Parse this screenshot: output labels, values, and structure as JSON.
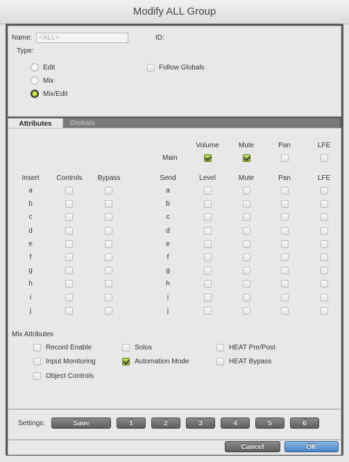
{
  "window": {
    "title": "Modify ALL Group"
  },
  "group": {
    "name_label": "Name:",
    "name_value": "<ALL>",
    "id_label": "ID:",
    "type_label": "Type:",
    "type_options": [
      "Edit",
      "Mix",
      "Mix/Edit"
    ],
    "type_selected": "Mix/Edit",
    "follow_globals_label": "Follow Globals",
    "follow_globals_checked": false
  },
  "tabs": [
    {
      "label": "Attributes",
      "active": true
    },
    {
      "label": "Globals",
      "active": false
    }
  ],
  "attributes": {
    "main": {
      "row_label": "Main",
      "columns": [
        "Volume",
        "Mute",
        "Pan",
        "LFE"
      ],
      "checked": [
        true,
        true,
        false,
        false
      ]
    },
    "insert": {
      "headers": [
        "Insert",
        "Controls",
        "Bypass"
      ],
      "rows": [
        "a",
        "b",
        "c",
        "d",
        "e",
        "f",
        "g",
        "h",
        "i",
        "j"
      ]
    },
    "send": {
      "headers": [
        "Send",
        "Level",
        "Mute",
        "Pan",
        "LFE"
      ],
      "rows": [
        "a",
        "b",
        "c",
        "d",
        "e",
        "f",
        "g",
        "h",
        "i",
        "j"
      ]
    }
  },
  "mix_attributes": {
    "title": "Mix Attributes",
    "items": [
      {
        "label": "Record Enable",
        "checked": false
      },
      {
        "label": "Input Monitoring",
        "checked": false
      },
      {
        "label": "Object Controls",
        "checked": false
      },
      {
        "label": "Solos",
        "checked": false
      },
      {
        "label": "Automation Mode",
        "checked": true
      },
      {
        "label": "HEAT Pre/Post",
        "checked": false
      },
      {
        "label": "HEAT Bypass",
        "checked": false
      }
    ]
  },
  "settings": {
    "label": "Settings:",
    "save_label": "Save",
    "slots": [
      "1",
      "2",
      "3",
      "4",
      "5",
      "6"
    ]
  },
  "dialog_buttons": {
    "cancel": "Cancel",
    "ok": "OK"
  },
  "colors": {
    "accent_green": "#8cb62c",
    "ok_blue": "#4a82c2",
    "frame": "#5a5a5a"
  }
}
